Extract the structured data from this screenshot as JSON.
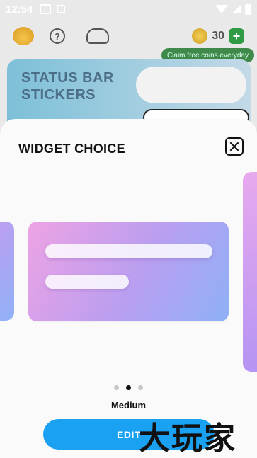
{
  "status_bar": {
    "time": "12:54"
  },
  "background_app": {
    "coin_count": "30",
    "claim_tooltip": "Claim free coins everyday",
    "banner_title_line1": "STATUS BAR",
    "banner_title_line2": "STICKERS"
  },
  "sheet": {
    "title": "WIDGET CHOICE",
    "size_label": "Medium",
    "edit_label": "EDIT",
    "pager": {
      "count": 3,
      "active_index": 1
    }
  },
  "watermark": "大玩家"
}
